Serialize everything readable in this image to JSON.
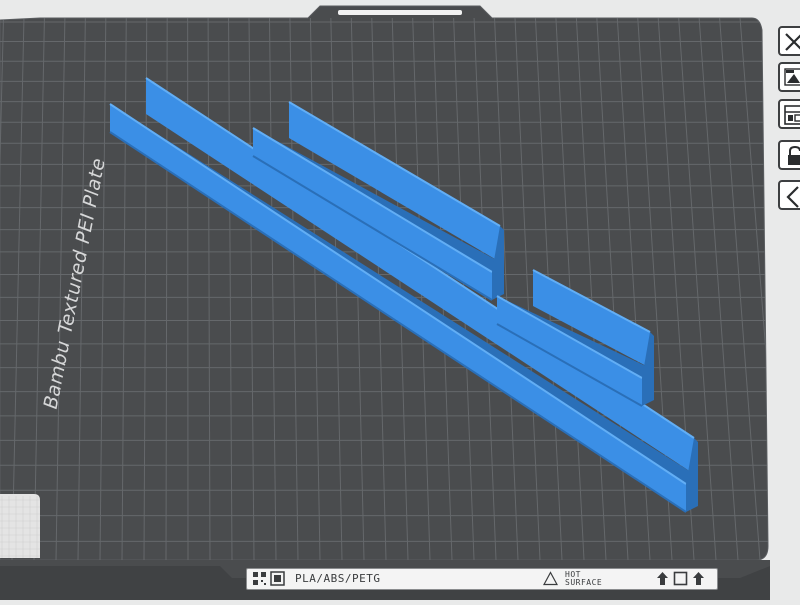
{
  "plate": {
    "name": "Bambu Textured PEI Plate",
    "filament_label": "PLA/ABS/PETG",
    "hot_surface_line1": "HOT",
    "hot_surface_line2": "SURFACE"
  },
  "colors": {
    "background": "#e9eaea",
    "plate": "#4a4c4e",
    "grid": "#65686b",
    "model": "#3b8fe6",
    "model_dark": "#2a6fb8",
    "model_light": "#62aef5",
    "x_axis": "#d91c1c"
  },
  "toolbar_icons": [
    "close-icon",
    "auto-arrange-icon",
    "plate-layout-icon",
    "lock-icon",
    "collapse-icon"
  ],
  "bottom_strip_icons": [
    "qr-code-icon",
    "plate-type-icon",
    "warning-triangle-icon",
    "arrow-up-icon",
    "plate-square-icon"
  ],
  "models": [
    "u-channel-long",
    "u-channel-medium",
    "u-channel-short"
  ]
}
